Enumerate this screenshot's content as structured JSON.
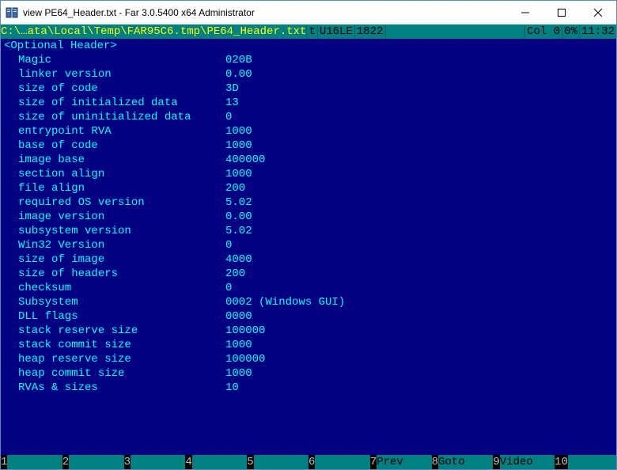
{
  "window": {
    "title": "view PE64_Header.txt - Far 3.0.5400 x64 Administrator"
  },
  "statusbar": {
    "path": "C:\\…ata\\Local\\Temp\\FAR95C6.tmp\\PE64_Header.txt",
    "mode": "t",
    "encoding": "U16LE",
    "size": "1822",
    "col": "Col 0",
    "percent": "0%",
    "time": "11:32"
  },
  "section_title": "<Optional Header>",
  "fields": [
    {
      "key": "Magic",
      "val": "020B"
    },
    {
      "key": "linker version",
      "val": "0.00"
    },
    {
      "key": "size of code",
      "val": "3D"
    },
    {
      "key": "size of initialized data",
      "val": "13"
    },
    {
      "key": "size of uninitialized data",
      "val": "0"
    },
    {
      "key": "entrypoint RVA",
      "val": "1000"
    },
    {
      "key": "base of code",
      "val": "1000"
    },
    {
      "key": "image base",
      "val": "400000"
    },
    {
      "key": "section align",
      "val": "1000"
    },
    {
      "key": "file align",
      "val": "200"
    },
    {
      "key": "required OS version",
      "val": "5.02"
    },
    {
      "key": "image version",
      "val": "0.00"
    },
    {
      "key": "subsystem version",
      "val": "5.02"
    },
    {
      "key": "Win32 Version",
      "val": "0"
    },
    {
      "key": "size of image",
      "val": "4000"
    },
    {
      "key": "size of headers",
      "val": "200"
    },
    {
      "key": "checksum",
      "val": "0"
    },
    {
      "key": "Subsystem",
      "val": "0002 (Windows GUI)"
    },
    {
      "key": "DLL flags",
      "val": "0000"
    },
    {
      "key": "stack reserve size",
      "val": "100000"
    },
    {
      "key": "stack commit size",
      "val": "1000"
    },
    {
      "key": "heap reserve size",
      "val": "100000"
    },
    {
      "key": "heap commit size",
      "val": "1000"
    },
    {
      "key": "RVAs & sizes",
      "val": "10"
    }
  ],
  "keybar": [
    {
      "num": "1",
      "label": "     "
    },
    {
      "num": "2",
      "label": "     "
    },
    {
      "num": "3",
      "label": "     "
    },
    {
      "num": "4",
      "label": "     "
    },
    {
      "num": "5",
      "label": "     "
    },
    {
      "num": "6",
      "label": "     "
    },
    {
      "num": "7",
      "label": "Prev "
    },
    {
      "num": "8",
      "label": "Goto "
    },
    {
      "num": "9",
      "label": "Video"
    },
    {
      "num": "10",
      "label": "     "
    }
  ]
}
